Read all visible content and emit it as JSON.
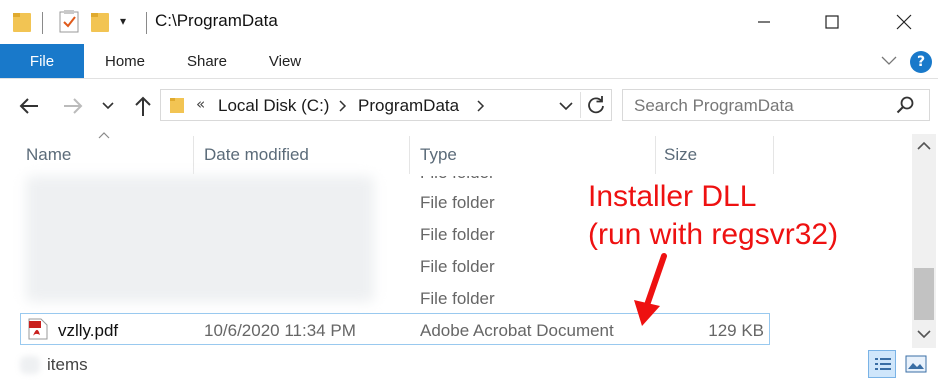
{
  "titlebar": {
    "path": "C:\\ProgramData",
    "caret": "▾",
    "minimize": "—",
    "maximize": "☐",
    "close": "✕"
  },
  "ribbon": {
    "tabs": [
      "File",
      "Home",
      "Share",
      "View"
    ],
    "help": "?"
  },
  "address": {
    "overflow": "«",
    "crumbs": [
      "Local Disk (C:)",
      "ProgramData"
    ],
    "search_placeholder": "Search ProgramData"
  },
  "columns": {
    "name": "Name",
    "date_modified": "Date modified",
    "type": "Type",
    "size": "Size"
  },
  "rows": [
    {
      "type": "File folder"
    },
    {
      "type": "File folder"
    },
    {
      "type": "File folder"
    },
    {
      "type": "File folder"
    },
    {
      "type": "File folder"
    }
  ],
  "selected_file": {
    "name": "vzlly.pdf",
    "date": "10/6/2020 11:34 PM",
    "type": "Adobe Acrobat Document",
    "size": "129 KB"
  },
  "status": {
    "items_label": "items"
  },
  "annotation": {
    "line1": "Installer DLL",
    "line2": "(run with regsvr32)"
  },
  "colors": {
    "accent": "#1979ca",
    "annotation": "#ee1111",
    "selection_border": "#99c9ef"
  }
}
